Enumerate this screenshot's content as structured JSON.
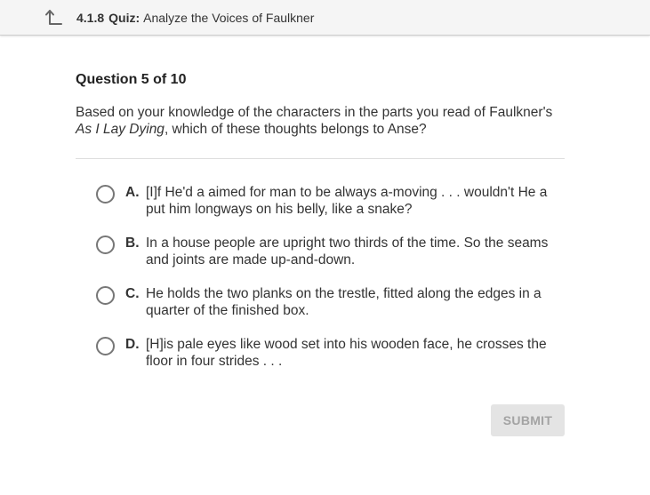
{
  "topbar": {
    "back_icon": "back-up-arrow-icon",
    "lesson_number": "4.1.8",
    "activity_type": "Quiz:",
    "activity_title": "Analyze the Voices of Faulkner"
  },
  "question": {
    "header": "Question 5 of 10",
    "prompt_before": "Based on your knowledge of the characters in the parts you read of Faulkner's ",
    "prompt_title": "As I Lay Dying",
    "prompt_after": ", which of these thoughts belongs to Anse?"
  },
  "options": [
    {
      "letter": "A.",
      "text": "[I]f He'd a aimed for man to be always a-moving . . . wouldn't He a put him longways on his belly, like a snake?"
    },
    {
      "letter": "B.",
      "text": "In a house people are upright two thirds of the time. So the seams and joints are made up-and-down."
    },
    {
      "letter": "C.",
      "text": "He holds the two planks on the trestle, fitted along the edges in a quarter of the finished box."
    },
    {
      "letter": "D.",
      "text": "[H]is pale eyes like wood set into his wooden face, he crosses the floor in four strides . . ."
    }
  ],
  "submit_label": "SUBMIT"
}
